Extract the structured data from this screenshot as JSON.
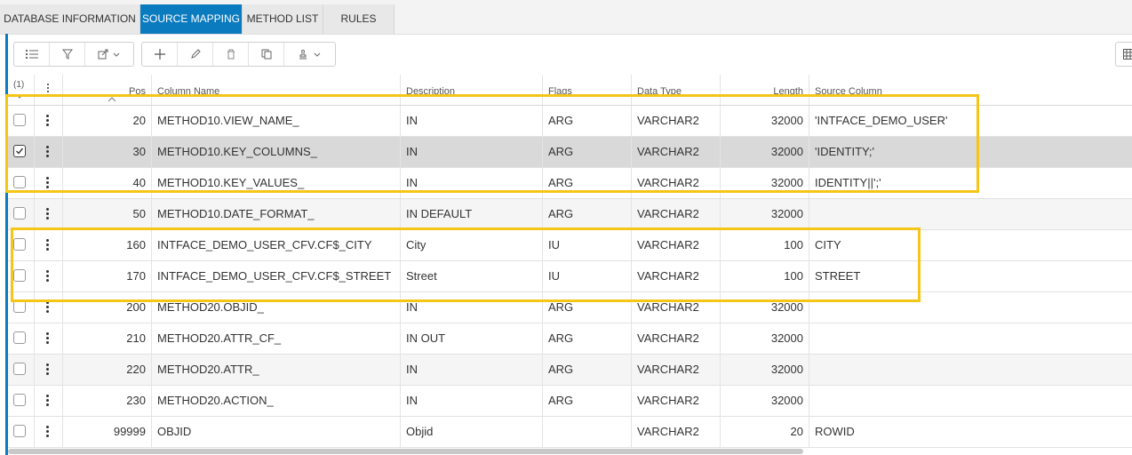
{
  "tabs": [
    {
      "label": "DATABASE INFORMATION",
      "active": false
    },
    {
      "label": "SOURCE MAPPING",
      "active": true
    },
    {
      "label": "METHOD LIST",
      "active": false
    },
    {
      "label": "RULES",
      "active": false
    }
  ],
  "toolbar": {
    "icons": [
      "list-icon",
      "filter-icon",
      "export-icon",
      "add-icon",
      "edit-icon",
      "delete-icon",
      "copy-icon",
      "stamp-icon",
      "table-icon"
    ]
  },
  "grid": {
    "selection_count": "(1)",
    "columns": [
      "Pos",
      "Column Name",
      "Description",
      "Flags",
      "Data Type",
      "Length",
      "Source Column"
    ],
    "rows": [
      {
        "pos": "20",
        "column_name": "METHOD10.VIEW_NAME_",
        "description": "IN",
        "flags": "ARG",
        "data_type": "VARCHAR2",
        "length": "32000",
        "source_column": "'INTFACE_DEMO_USER'",
        "checked": false
      },
      {
        "pos": "30",
        "column_name": "METHOD10.KEY_COLUMNS_",
        "description": "IN",
        "flags": "ARG",
        "data_type": "VARCHAR2",
        "length": "32000",
        "source_column": "'IDENTITY;'",
        "checked": true
      },
      {
        "pos": "40",
        "column_name": "METHOD10.KEY_VALUES_",
        "description": "IN",
        "flags": "ARG",
        "data_type": "VARCHAR2",
        "length": "32000",
        "source_column": "IDENTITY||';'",
        "checked": false
      },
      {
        "pos": "50",
        "column_name": "METHOD10.DATE_FORMAT_",
        "description": "IN DEFAULT",
        "flags": "ARG",
        "data_type": "VARCHAR2",
        "length": "32000",
        "source_column": "",
        "checked": false
      },
      {
        "pos": "160",
        "column_name": "INTFACE_DEMO_USER_CFV.CF$_CITY",
        "description": "City",
        "flags": "IU",
        "data_type": "VARCHAR2",
        "length": "100",
        "source_column": "CITY",
        "checked": false
      },
      {
        "pos": "170",
        "column_name": "INTFACE_DEMO_USER_CFV.CF$_STREET",
        "description": "Street",
        "flags": "IU",
        "data_type": "VARCHAR2",
        "length": "100",
        "source_column": "STREET",
        "checked": false
      },
      {
        "pos": "200",
        "column_name": "METHOD20.OBJID_",
        "description": "IN",
        "flags": "ARG",
        "data_type": "VARCHAR2",
        "length": "32000",
        "source_column": "",
        "checked": false
      },
      {
        "pos": "210",
        "column_name": "METHOD20.ATTR_CF_",
        "description": "IN OUT",
        "flags": "ARG",
        "data_type": "VARCHAR2",
        "length": "32000",
        "source_column": "",
        "checked": false
      },
      {
        "pos": "220",
        "column_name": "METHOD20.ATTR_",
        "description": "IN",
        "flags": "ARG",
        "data_type": "VARCHAR2",
        "length": "32000",
        "source_column": "",
        "checked": false
      },
      {
        "pos": "230",
        "column_name": "METHOD20.ACTION_",
        "description": "IN",
        "flags": "ARG",
        "data_type": "VARCHAR2",
        "length": "32000",
        "source_column": "",
        "checked": false
      },
      {
        "pos": "99999",
        "column_name": "OBJID",
        "description": "Objid",
        "flags": "",
        "data_type": "VARCHAR2",
        "length": "20",
        "source_column": "ROWID",
        "checked": false
      }
    ]
  },
  "colors": {
    "accent": "#0a7bbf",
    "highlight": "#f5c518",
    "selected_row": "#d9d9d9"
  }
}
